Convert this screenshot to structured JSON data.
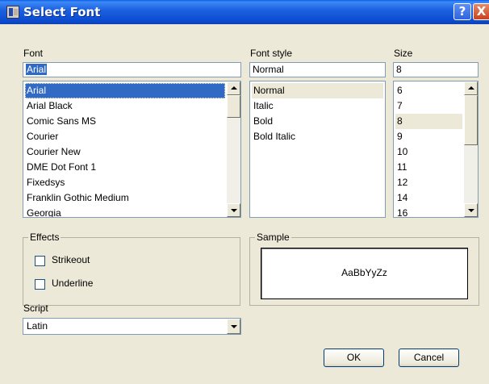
{
  "window": {
    "title": "Select Font"
  },
  "titlebar_buttons": {
    "help": "?",
    "close": "X"
  },
  "font": {
    "label": "Font",
    "value": "Arial",
    "items": [
      "Arial",
      "Arial Black",
      "Comic Sans MS",
      "Courier",
      "Courier New",
      "DME Dot Font 1",
      "Fixedsys",
      "Franklin Gothic Medium",
      "Georgia"
    ],
    "selected": "Arial"
  },
  "font_style": {
    "label": "Font style",
    "value": "Normal",
    "items": [
      "Normal",
      "Italic",
      "Bold",
      "Bold Italic"
    ],
    "selected": "Normal"
  },
  "size": {
    "label": "Size",
    "value": "8",
    "items": [
      "6",
      "7",
      "8",
      "9",
      "10",
      "11",
      "12",
      "14",
      "16"
    ],
    "selected": "8"
  },
  "effects": {
    "title": "Effects",
    "strikeout": {
      "label": "Strikeout",
      "checked": false
    },
    "underline": {
      "label": "Underline",
      "checked": false
    }
  },
  "sample": {
    "title": "Sample",
    "text": "AaBbYyZz"
  },
  "script": {
    "label": "Script",
    "value": "Latin"
  },
  "buttons": {
    "ok": "OK",
    "cancel": "Cancel"
  },
  "colors": {
    "titlebar": "#0b4cd2",
    "selection": "#316ac5",
    "dialog_bg": "#ece9d8",
    "close_button": "#c9411c"
  }
}
